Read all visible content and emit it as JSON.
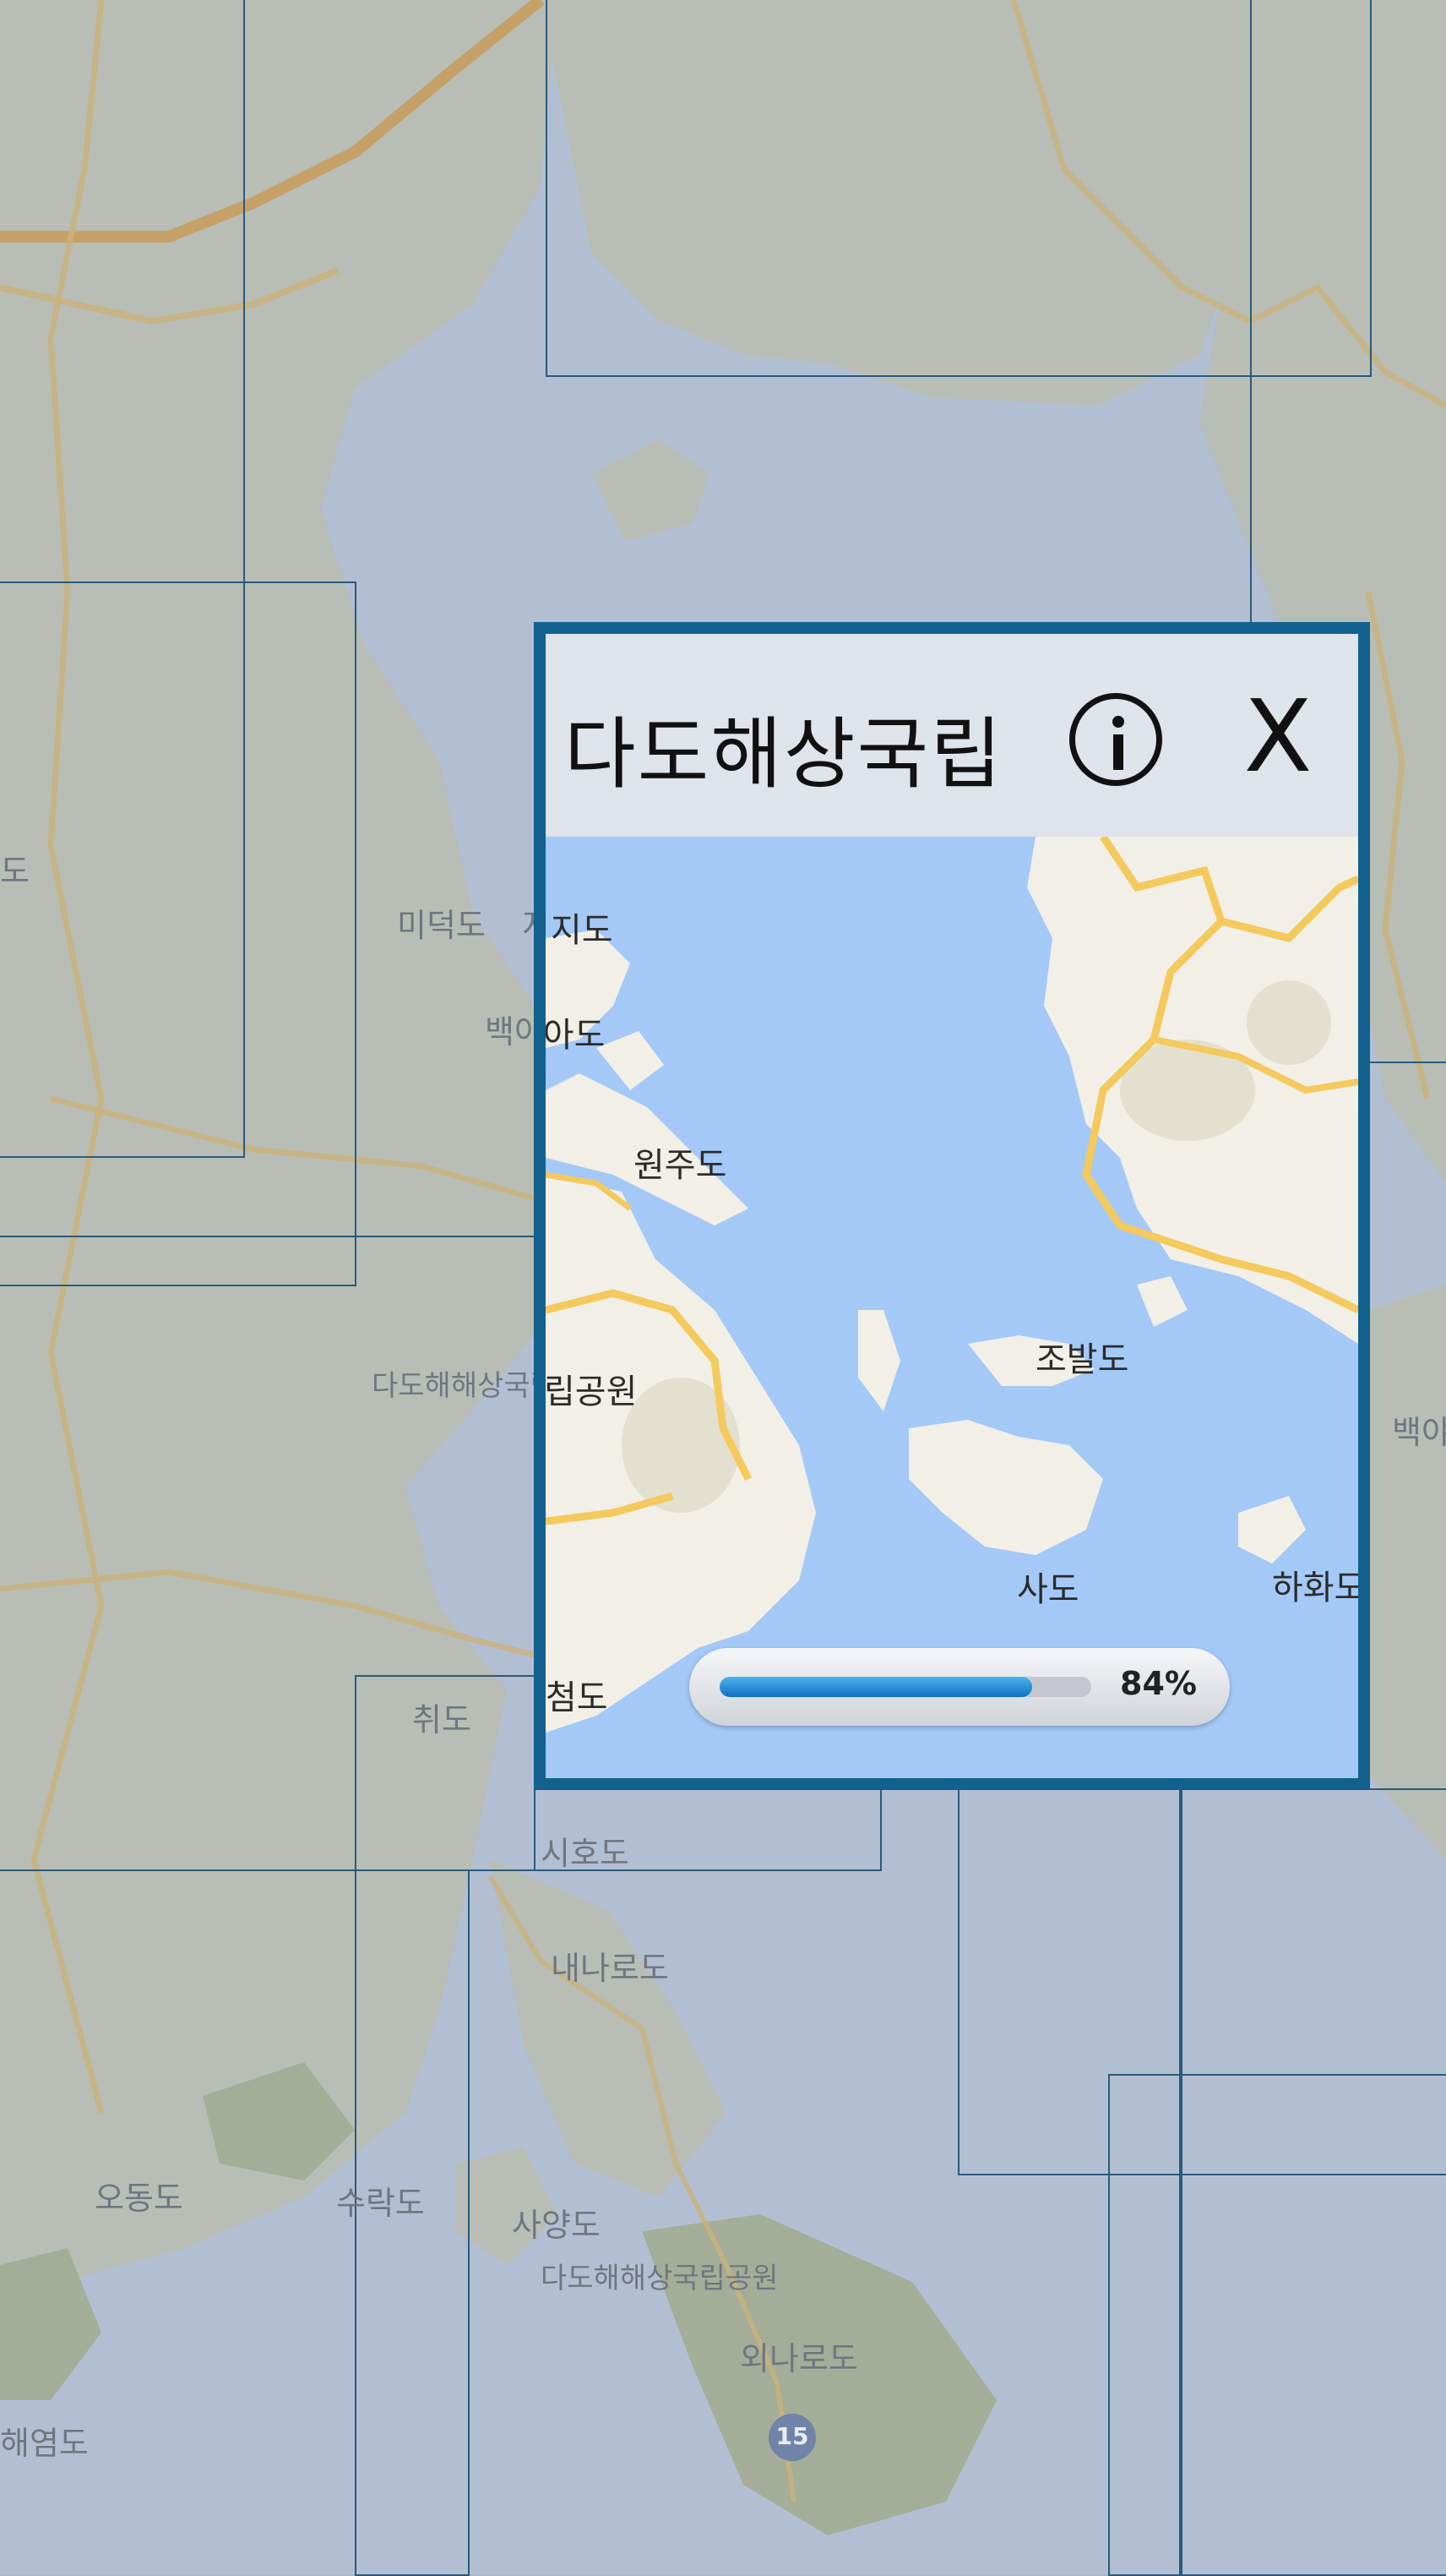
{
  "popup": {
    "title": "다도해상국립",
    "info_icon": "info-icon",
    "close_label": "X",
    "progress_percent": 84,
    "progress_text": "84%",
    "map_labels": [
      "지도",
      "백아도",
      "원주도",
      "립공원",
      "조발도",
      "사도",
      "하화도",
      "첨도"
    ]
  },
  "background_map": {
    "labels": [
      "미덕도",
      "지도",
      "백야도",
      "다도해해상국립공원",
      "취도",
      "시호도",
      "내나로도",
      "오동도",
      "수락도",
      "사양도",
      "다도해해상국립공원",
      "외나로도",
      "백야",
      "해염도",
      "도"
    ],
    "route_shield": "15"
  },
  "colors": {
    "popup_border": "#12618e",
    "sea": "#a4c9f7",
    "land": "#f1efe6",
    "road": "#f4c95d",
    "overlay": "#a9b6c9",
    "progress_fill": "#1e88d8"
  }
}
